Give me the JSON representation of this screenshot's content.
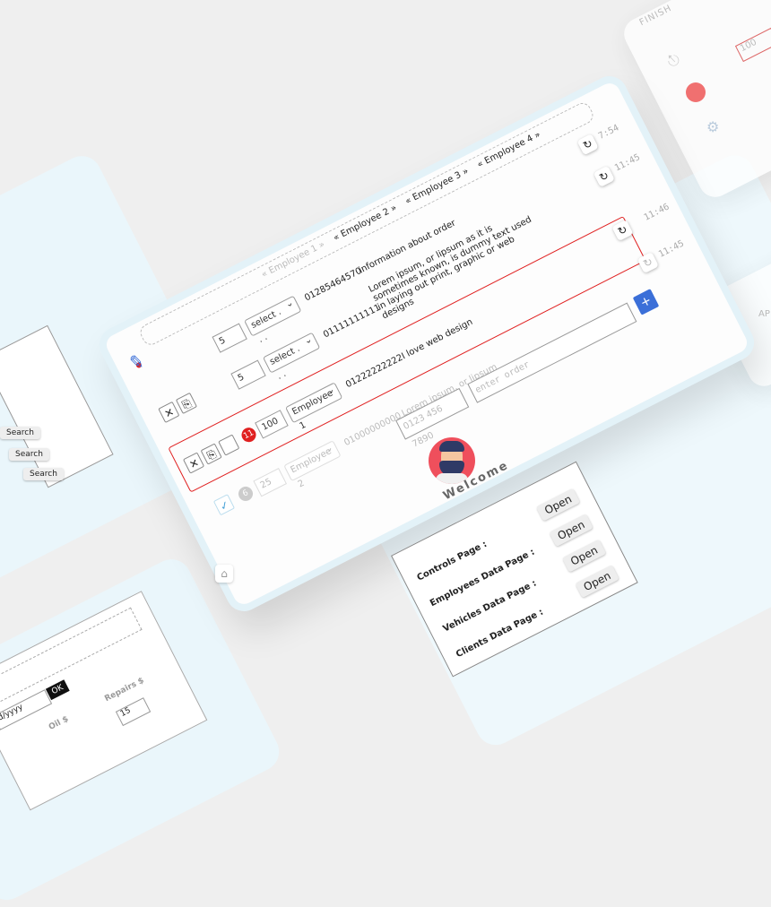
{
  "board": {
    "employee_tabs": [
      "« Employee 1 »",
      "« Employee 2 »",
      "« Employee 3 »",
      "« Employee 4 »"
    ],
    "rows": [
      {
        "qty": "5",
        "select": "select . . .",
        "phone": "01285464570",
        "note": "information about order",
        "time": "7:54"
      },
      {
        "qty": "5",
        "select": "select . . .",
        "phone": "01111111111",
        "note": "Lorem ipsum, or lipsum as it is sometimes known, is dummy text used in laying out print, graphic or web designs",
        "time": "11:45"
      },
      {
        "badge": "11",
        "price": "100",
        "select": "Employee 1",
        "phone": "01222222222",
        "note": "I love web design",
        "time": "11:46"
      },
      {
        "badge": "6",
        "price": "25",
        "select": "Employee 2",
        "phone": "01000000000",
        "note": "Lorem ipsum, or lipsum",
        "time": "11:45"
      }
    ],
    "phone_placeholder": "0123 456 7890",
    "order_placeholder": "enter order",
    "add_label": "+"
  },
  "welcome": {
    "title": "Welcome",
    "links": [
      {
        "label": "Controls Page :",
        "button": "Open"
      },
      {
        "label": "Employees Data Page :",
        "button": "Open"
      },
      {
        "label": "Vehicles Data Page :",
        "button": "Open"
      },
      {
        "label": "Clients Data Page :",
        "button": "Open"
      }
    ]
  },
  "right_panel": {
    "finish_label": "FINISH",
    "value": "100",
    "apps_label": "AP"
  },
  "left_panel": {
    "search_label": "Search",
    "ok_label": "OK",
    "date_placeholder": "d/yyyy",
    "oil_col": "Oil $",
    "repairs_col": "Repairs $",
    "repairs_value": "15"
  },
  "colors": {
    "accent": "#3b6fd8",
    "alert": "#e02020",
    "panel": "#eaf6fb"
  }
}
